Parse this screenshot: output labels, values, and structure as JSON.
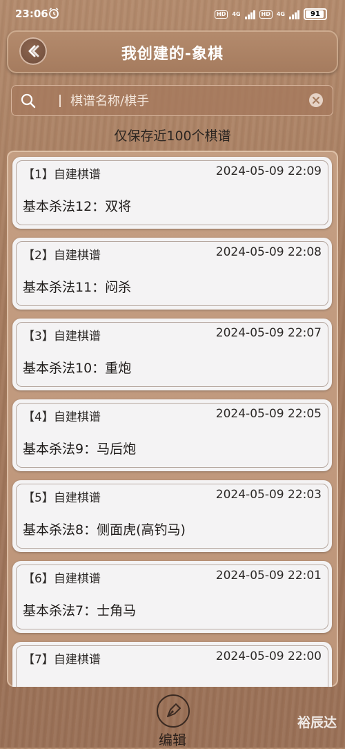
{
  "status_bar": {
    "time": "23:06",
    "hd1": "HD",
    "net1": "4G",
    "hd2": "HD",
    "net2": "4G",
    "battery": "91"
  },
  "header": {
    "title": "我创建的-象棋",
    "back_icon": "back-arrow-icon"
  },
  "search": {
    "placeholder": "棋谱名称/棋手",
    "value": "",
    "icon": "search-icon",
    "clear_icon": "clear-icon"
  },
  "notice": "仅保存近100个棋谱",
  "records": [
    {
      "tag": "【1】自建棋谱",
      "time": "2024-05-09 22:09",
      "name": "基本杀法12：双将"
    },
    {
      "tag": "【2】自建棋谱",
      "time": "2024-05-09 22:08",
      "name": "基本杀法11：闷杀"
    },
    {
      "tag": "【3】自建棋谱",
      "time": "2024-05-09 22:07",
      "name": "基本杀法10：重炮"
    },
    {
      "tag": "【4】自建棋谱",
      "time": "2024-05-09 22:05",
      "name": "基本杀法9：马后炮"
    },
    {
      "tag": "【5】自建棋谱",
      "time": "2024-05-09 22:03",
      "name": "基本杀法8：侧面虎(高钓马)"
    },
    {
      "tag": "【6】自建棋谱",
      "time": "2024-05-09 22:01",
      "name": "基本杀法7：士角马"
    },
    {
      "tag": "【7】自建棋谱",
      "time": "2024-05-09 22:00",
      "name": ""
    }
  ],
  "bottom": {
    "edit_label": "编辑",
    "edit_icon": "pen-nib-icon"
  },
  "watermark": "裕辰达",
  "colors": {
    "wood": "#a47a5d",
    "card": "#f4f3f4",
    "text": "#2d2a28"
  }
}
